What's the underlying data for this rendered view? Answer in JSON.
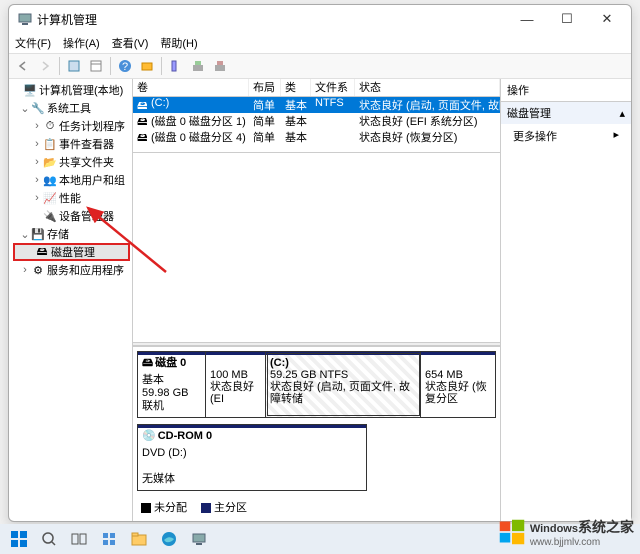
{
  "window": {
    "title": "计算机管理",
    "menu": [
      "文件(F)",
      "操作(A)",
      "查看(V)",
      "帮助(H)"
    ]
  },
  "tree": {
    "root": "计算机管理(本地)",
    "sys_tools": "系统工具",
    "task_sched": "任务计划程序",
    "event_viewer": "事件查看器",
    "shared": "共享文件夹",
    "local_users": "本地用户和组",
    "perf": "性能",
    "devmgr": "设备管理器",
    "storage": "存储",
    "diskmgmt": "磁盘管理",
    "services": "服务和应用程序"
  },
  "vol_cols": {
    "vol": "卷",
    "layout": "布局",
    "type": "类型",
    "fs": "文件系统",
    "status": "状态"
  },
  "volumes": [
    {
      "name": "(C:)",
      "layout": "简单",
      "type": "基本",
      "fs": "NTFS",
      "status": "状态良好 (启动, 页面文件, 故障转储, 基本数据"
    },
    {
      "name": "(磁盘 0 磁盘分区 1)",
      "layout": "简单",
      "type": "基本",
      "fs": "",
      "status": "状态良好 (EFI 系统分区)"
    },
    {
      "name": "(磁盘 0 磁盘分区 4)",
      "layout": "简单",
      "type": "基本",
      "fs": "",
      "status": "状态良好 (恢复分区)"
    }
  ],
  "disk0": {
    "title": "磁盘 0",
    "type": "基本",
    "size": "59.98 GB",
    "state": "联机",
    "parts": [
      {
        "label": "",
        "size": "100 MB",
        "status": "状态良好 (EI"
      },
      {
        "label": "(C:)",
        "size": "59.25 GB NTFS",
        "status": "状态良好 (启动, 页面文件, 故障转储"
      },
      {
        "label": "",
        "size": "654 MB",
        "status": "状态良好 (恢复分区"
      }
    ]
  },
  "cdrom": {
    "title": "CD-ROM 0",
    "drive": "DVD (D:)",
    "state": "无媒体"
  },
  "legend": {
    "unalloc": "未分配",
    "primary": "主分区"
  },
  "actions": {
    "header": "操作",
    "section": "磁盘管理",
    "more": "更多操作"
  },
  "watermark": {
    "brand": "Windows",
    "sub1": "系统之家",
    "sub2": "www.bjjmlv.com"
  }
}
